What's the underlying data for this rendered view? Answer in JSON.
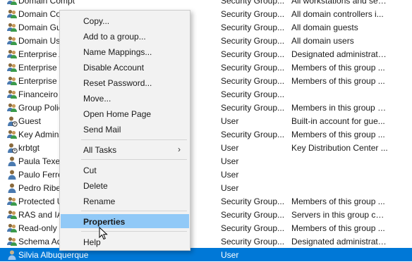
{
  "rows": [
    {
      "name": "Domain Computers",
      "type": "Security Group...",
      "desc": "All workstations and serve...",
      "icon": "group-icon"
    },
    {
      "name": "Domain Controllers",
      "type": "Security Group...",
      "desc": "All domain controllers i...",
      "icon": "group-icon"
    },
    {
      "name": "Domain Guests",
      "type": "Security Group...",
      "desc": "All domain guests",
      "icon": "group-icon"
    },
    {
      "name": "Domain Users",
      "type": "Security Group...",
      "desc": "All domain users",
      "icon": "group-icon"
    },
    {
      "name": "Enterprise Admins",
      "type": "Security Group...",
      "desc": "Designated administrato...",
      "icon": "group-icon"
    },
    {
      "name": "Enterprise Key Admins",
      "type": "Security Group...",
      "desc": "Members of this group ...",
      "icon": "group-icon"
    },
    {
      "name": "Enterprise Read-only",
      "type": "Security Group...",
      "desc": "Members of this group ...",
      "icon": "group-icon"
    },
    {
      "name": "Financeiro",
      "type": "Security Group...",
      "desc": "",
      "icon": "group-icon"
    },
    {
      "name": "Group Policy Creator",
      "type": "Security Group...",
      "desc": "Members in this group c...",
      "icon": "group-icon"
    },
    {
      "name": "Guest",
      "type": "User",
      "desc": "Built-in account for gue...",
      "icon": "disabled-user-icon"
    },
    {
      "name": "Key Admins",
      "type": "Security Group...",
      "desc": "Members of this group ...",
      "icon": "group-icon"
    },
    {
      "name": "krbtgt",
      "type": "User",
      "desc": "Key Distribution Center ...",
      "icon": "disabled-user-icon"
    },
    {
      "name": "Paula Texeira",
      "type": "User",
      "desc": "",
      "icon": "user-icon"
    },
    {
      "name": "Paulo Ferreira",
      "type": "User",
      "desc": "",
      "icon": "user-icon"
    },
    {
      "name": "Pedro Ribeiro",
      "type": "User",
      "desc": "",
      "icon": "user-icon"
    },
    {
      "name": "Protected Users",
      "type": "Security Group...",
      "desc": "Members of this group ...",
      "icon": "group-icon"
    },
    {
      "name": "RAS and IAS Servers",
      "type": "Security Group...",
      "desc": "Servers in this group can...",
      "icon": "group-icon"
    },
    {
      "name": "Read-only Domain",
      "type": "Security Group...",
      "desc": "Members of this group ...",
      "icon": "group-icon"
    },
    {
      "name": "Schema Admins",
      "type": "Security Group...",
      "desc": "Designated administrato...",
      "icon": "group-icon"
    },
    {
      "name": "Silvia Albuquerque",
      "type": "User",
      "desc": "",
      "icon": "user-icon",
      "selected": true
    }
  ],
  "context_menu": {
    "copy": "Copy...",
    "add_to_group": "Add to a group...",
    "name_mappings": "Name Mappings...",
    "disable_account": "Disable Account",
    "reset_password": "Reset Password...",
    "move": "Move...",
    "open_home_page": "Open Home Page",
    "send_mail": "Send Mail",
    "all_tasks": "All Tasks",
    "all_tasks_arrow": "›",
    "cut": "Cut",
    "delete": "Delete",
    "rename": "Rename",
    "properties": "Properties",
    "help": "Help"
  },
  "colors": {
    "selection": "#0078d7",
    "menu_highlight": "#91c9f7",
    "menu_background": "#f2f2f2"
  }
}
